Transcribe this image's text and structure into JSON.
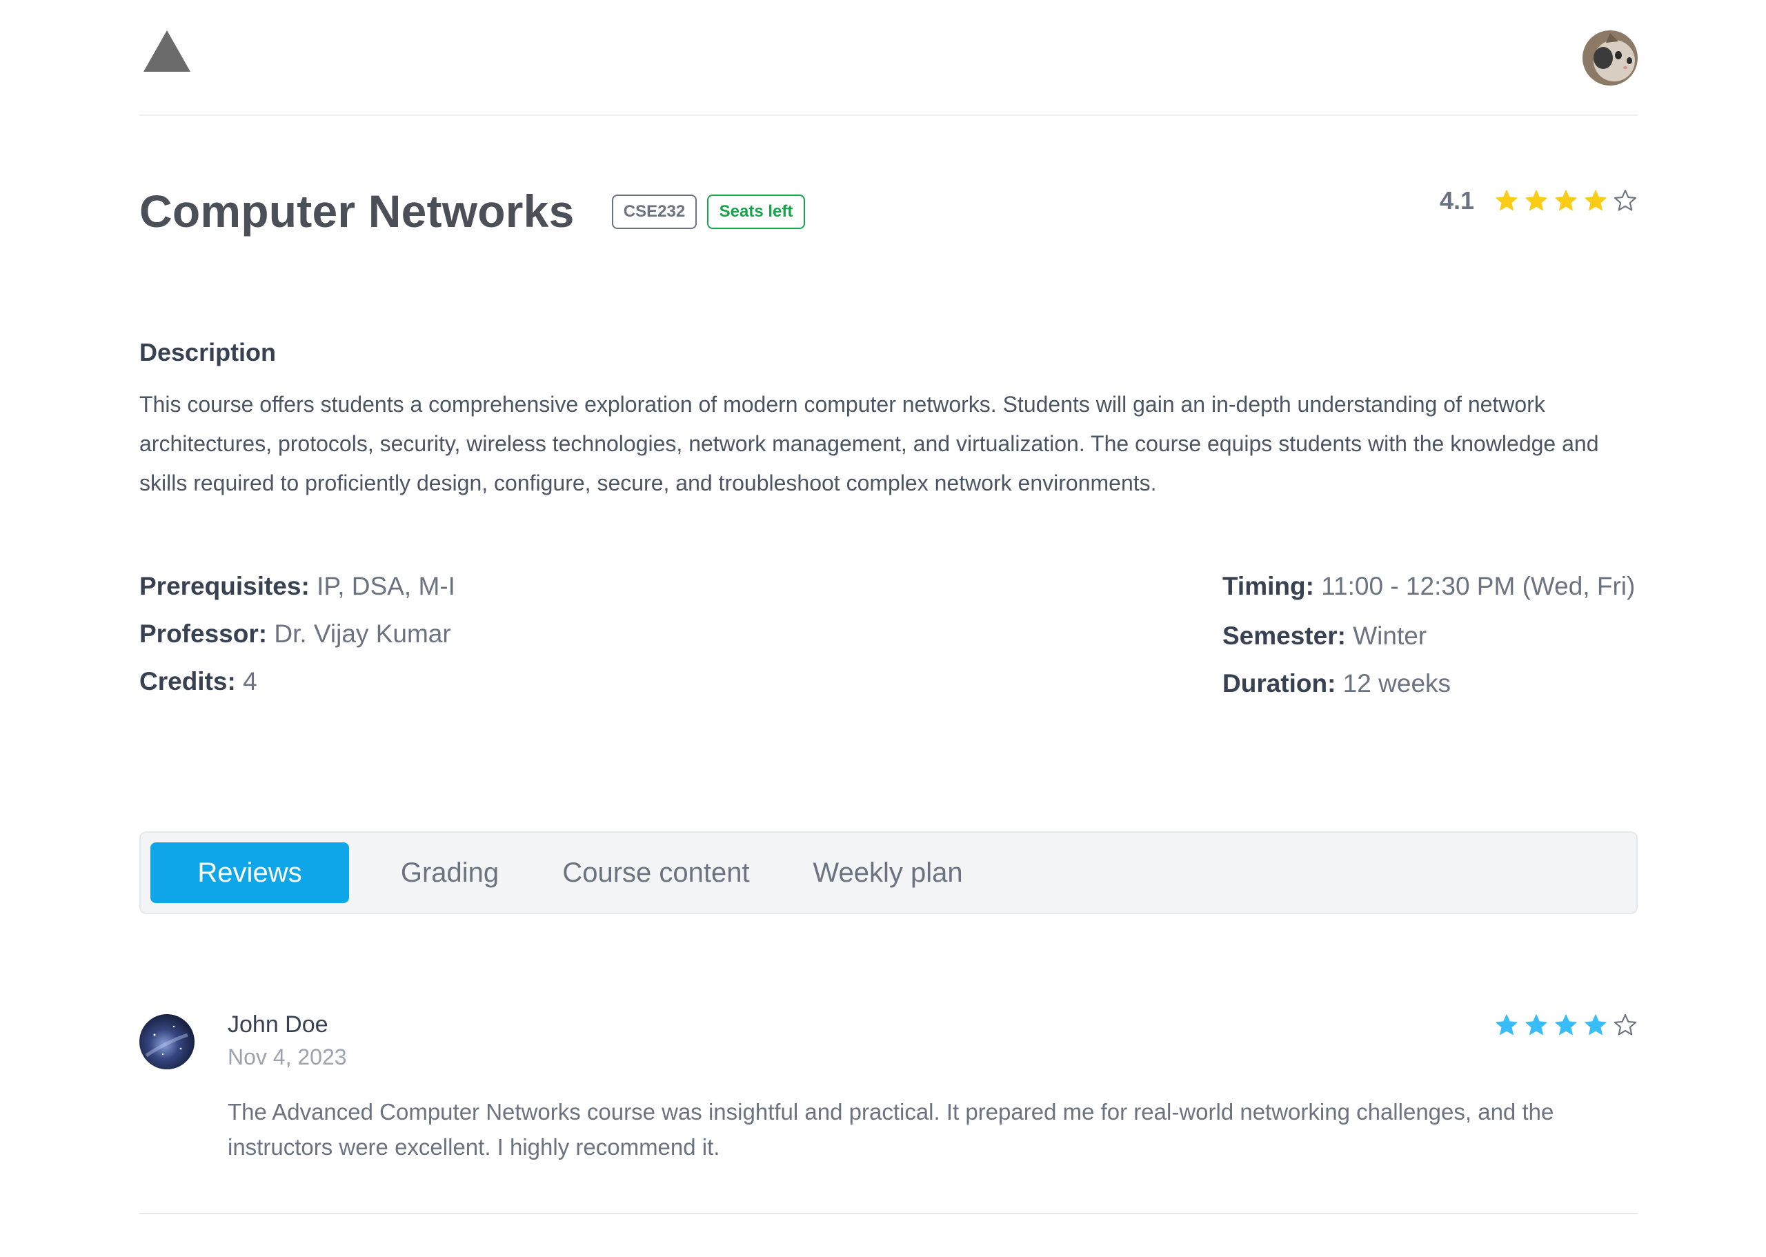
{
  "header": {
    "logo_icon": "triangle-logo-icon",
    "avatar_icon": "user-avatar-cat"
  },
  "course": {
    "title": "Computer Networks",
    "code": "CSE232",
    "seats_badge": "Seats left",
    "rating": "4.1",
    "rating_stars": 4,
    "rating_max": 5
  },
  "description": {
    "heading": "Description",
    "text": "This course offers students a comprehensive exploration of modern computer networks. Students will gain an in-depth understanding of network architectures, protocols, security, wireless technologies, network management, and virtualization. The course equips students with the knowledge and skills required to proficiently design, configure, secure, and troubleshoot complex network environments."
  },
  "details": {
    "prerequisites_label": "Prerequisites:",
    "prerequisites_value": "IP, DSA, M-I",
    "professor_label": "Professor:",
    "professor_value": "Dr. Vijay Kumar",
    "credits_label": "Credits:",
    "credits_value": "4",
    "timing_label": "Timing:",
    "timing_value": "11:00 - 12:30 PM (Wed, Fri)",
    "semester_label": "Semester:",
    "semester_value": "Winter",
    "duration_label": "Duration:",
    "duration_value": "12 weeks"
  },
  "tabs": [
    {
      "label": "Reviews",
      "active": true
    },
    {
      "label": "Grading",
      "active": false
    },
    {
      "label": "Course content",
      "active": false
    },
    {
      "label": "Weekly plan",
      "active": false
    }
  ],
  "reviews": [
    {
      "name": "John Doe",
      "date": "Nov 4, 2023",
      "stars": 4,
      "text": "The Advanced Computer Networks course was insightful and practical. It prepared me for real-world networking challenges, and the instructors were excellent. I highly recommend it."
    }
  ],
  "colors": {
    "accent": "#0ea5e9",
    "star_gold": "#facc15",
    "star_blue": "#38bdf8",
    "seats_green": "#16a34a"
  }
}
